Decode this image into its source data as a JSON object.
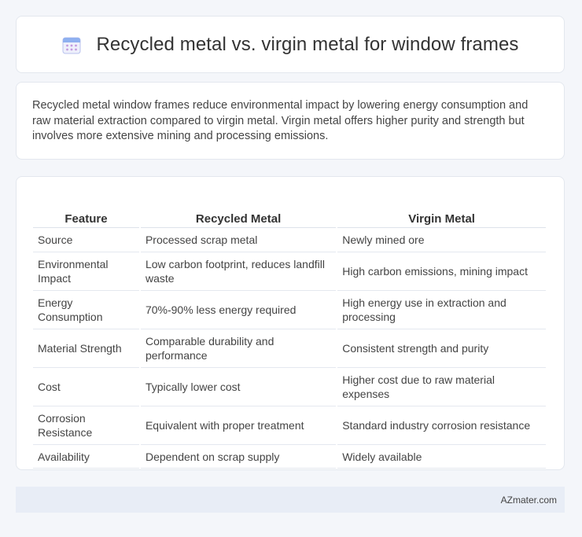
{
  "header": {
    "title": "Recycled metal vs. virgin metal for window frames",
    "icon": "calendar-icon"
  },
  "intro": {
    "text": "Recycled metal window frames reduce environmental impact by lowering energy consumption and raw material extraction compared to virgin metal. Virgin metal offers higher purity and strength but involves more extensive mining and processing emissions."
  },
  "table": {
    "headers": [
      "Feature",
      "Recycled Metal",
      "Virgin Metal"
    ],
    "rows": [
      [
        "Source",
        "Processed scrap metal",
        "Newly mined ore"
      ],
      [
        "Environmental Impact",
        "Low carbon footprint, reduces landfill waste",
        "High carbon emissions, mining impact"
      ],
      [
        "Energy Consumption",
        "70%-90% less energy required",
        "High energy use in extraction and processing"
      ],
      [
        "Material Strength",
        "Comparable durability and performance",
        "Consistent strength and purity"
      ],
      [
        "Cost",
        "Typically lower cost",
        "Higher cost due to raw material expenses"
      ],
      [
        "Corrosion Resistance",
        "Equivalent with proper treatment",
        "Standard industry corrosion resistance"
      ],
      [
        "Availability",
        "Dependent on scrap supply",
        "Widely available"
      ]
    ]
  },
  "footer": {
    "brand": "AZmater.com"
  },
  "colors": {
    "background": "#f4f6fa",
    "footer_bg": "#e8edf6",
    "icon_accent": "#8fb0f0"
  }
}
